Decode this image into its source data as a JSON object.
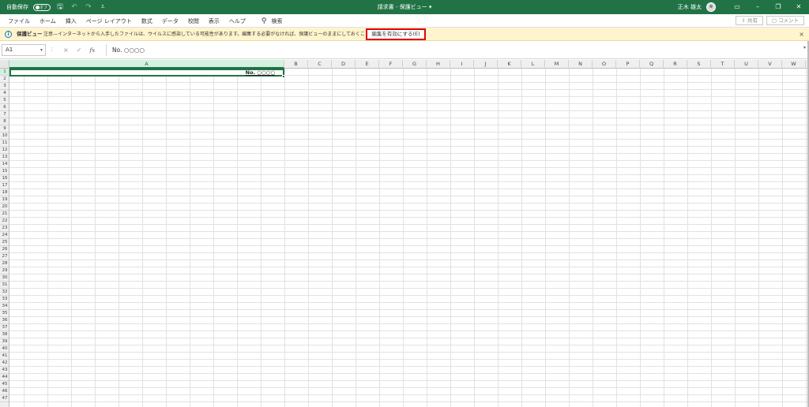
{
  "titlebar": {
    "autosave_label": "自動保存",
    "autosave_state": "オフ",
    "document_title": "請求書 - 保護ビュー",
    "title_dropdown": "▾",
    "user_name": "正木 雄太"
  },
  "ribbon": {
    "tabs": [
      "ファイル",
      "ホーム",
      "挿入",
      "ページ レイアウト",
      "数式",
      "データ",
      "校閲",
      "表示",
      "ヘルプ"
    ],
    "search_label": "検索",
    "share_label": "共有",
    "comment_label": "コメント"
  },
  "message_bar": {
    "title": "保護ビュー",
    "text": "注意—インターネットから入手したファイルは、ウイルスに感染している可能性があります。編集する必要がなければ、保護ビューのままにしておくことをお勧めします。",
    "enable_editing_label": "編集を有効にする(E)",
    "close_label": "×"
  },
  "formula_bar": {
    "name_box": "A1",
    "cancel_icon": "×",
    "enter_icon": "✓",
    "fx_label": "fx",
    "content": "No. ○○○○"
  },
  "grid": {
    "selected_cell": "A1",
    "cell_a1": "No. ○○○○",
    "columns": [
      "A",
      "B",
      "C",
      "D",
      "E",
      "F",
      "G",
      "H",
      "I",
      "J",
      "K",
      "L",
      "M",
      "N",
      "O",
      "P",
      "Q",
      "R",
      "S",
      "T",
      "U",
      "V",
      "W"
    ],
    "row_count": 47
  },
  "colors": {
    "excel_green": "#217346",
    "message_bar_bg": "#fff4ce",
    "highlight_red": "#e00000"
  }
}
